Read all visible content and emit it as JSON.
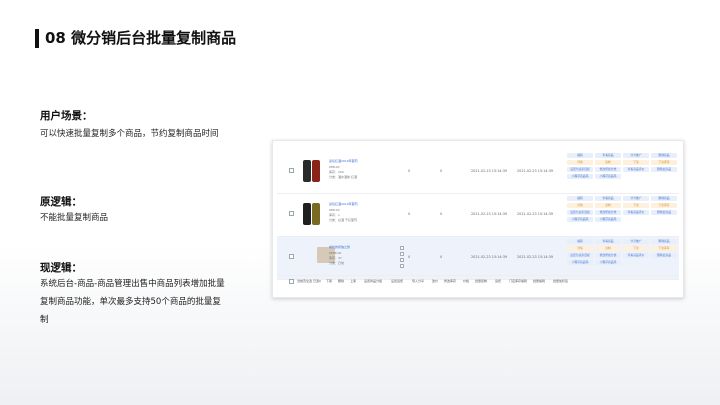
{
  "title": "08 微分销后台批量复制商品",
  "sections": {
    "scene_h": "用户场景：",
    "scene_t": "可以快速批量复制多个商品，节约复制商品时间",
    "orig_h": "原逻辑：",
    "orig_t": "不能批量复制商品",
    "now_h": "现逻辑：",
    "now_t": "系统后台-商品-商品管理出售中商品列表增加批量复制商品功能，单次最多支持50个商品的批量复制"
  },
  "table": {
    "rows": [
      {
        "name": "蓝莓红酒2019年葡萄",
        "price": "¥88.00",
        "stock": "库存：200",
        "cat": "分类：酒水酒类 红酒",
        "col1": "0",
        "col2": "0",
        "created": "2021-02-23 15:14:39",
        "updated": "2021-02-23 15:14:39",
        "ops": [
          "编辑",
          "查看商品",
          "分享推广",
          "删除商品",
          "详情",
          "复制",
          "下架",
          "下架库存",
          "设置为卖家自提",
          "修改所属分类",
          "查看商品评价",
          "删除此商品",
          "小程序商品码",
          "小程序商品码"
        ]
      },
      {
        "name": "蓝莓红酒2019年葡萄",
        "price": "¥88.00",
        "stock": "库存：1",
        "cat": "分类：白酒 干红葡萄",
        "col1": "0",
        "col2": "0",
        "created": "2021-02-23 15:14:39",
        "updated": "2021-02-23 15:14:39",
        "ops": [
          "编辑",
          "查看商品",
          "分享推广",
          "删除商品",
          "详情",
          "复制",
          "下架",
          "下架库存",
          "设置为卖家自提",
          "修改所属分类",
          "查看商品评价",
          "删除此商品",
          "小程序商品码",
          "小程序商品码"
        ]
      },
      {
        "name": "成长的烦恼之旅",
        "price": "¥688.00",
        "stock": "库存：37",
        "cat": "分类：日常",
        "col1": "0",
        "col2": "0",
        "created": "2021-02-23 15:14:39",
        "updated": "2021-02-23 15:14:39",
        "ops": [
          "编辑",
          "查看商品",
          "分享推广",
          "删除商品",
          "详情",
          "复制",
          "下架",
          "下架库存",
          "设置为卖家自提",
          "修改所属分类",
          "查看商品评价",
          "删除此商品",
          "小程序商品码",
          "小程序商品码"
        ]
      }
    ],
    "footer": [
      "当前页全选 已选0",
      "下架",
      "删除",
      "上架",
      "设置商品分组",
      "设置运费",
      "导入分享",
      "改价",
      "修改库存",
      "价格",
      "批量复制",
      "运费",
      "门店库存编辑",
      "批量编辑",
      "批量加标签"
    ]
  }
}
